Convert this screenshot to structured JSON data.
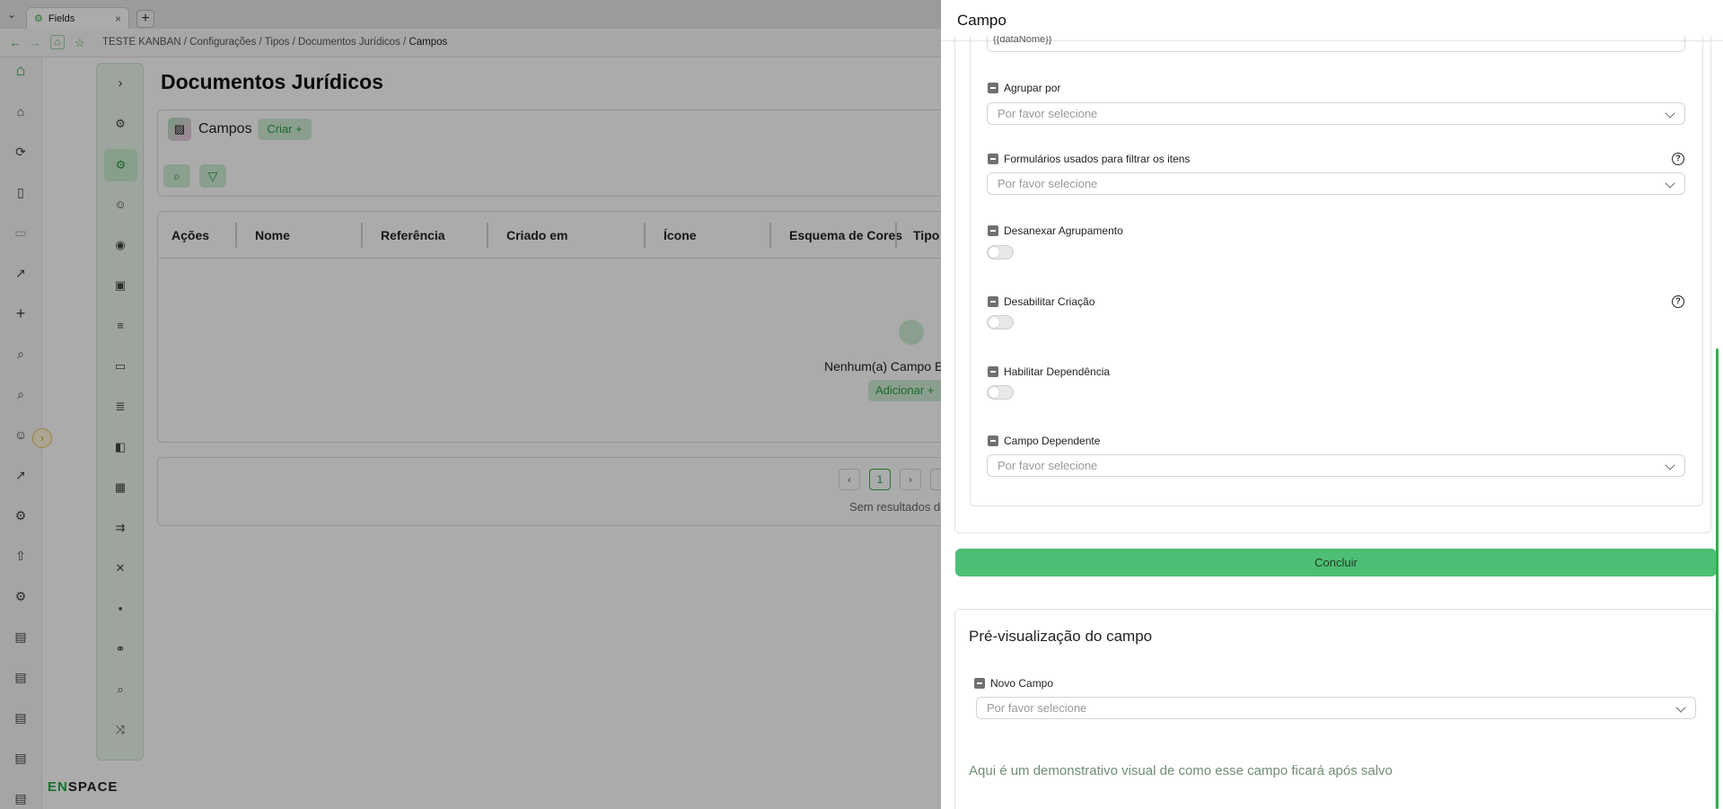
{
  "browser": {
    "tab_title": "Fields",
    "tab_close": "×",
    "new_tab": "+",
    "breadcrumbs": [
      "TESTE KANBAN",
      "Configurações",
      "Tipos",
      "Documentos Jurídicos",
      "Campos"
    ],
    "separator": "/"
  },
  "brand": {
    "logo_text_a": "EN",
    "logo_text_b": "SPACE"
  },
  "main": {
    "page_title": "Documentos Jurídicos",
    "section_title": "Campos",
    "criar_label": "Criar +",
    "table": {
      "headers": [
        "Ações",
        "Nome",
        "Referência",
        "Criado em",
        "Ícone",
        "Esquema de Cores",
        "Tipo"
      ]
    },
    "empty_text": "Nenhum(a) Campo Enc",
    "add_label": "Adicionar +",
    "pager": {
      "prev": "‹",
      "current": "1",
      "next": "›"
    },
    "no_results": "Sem resultados de"
  },
  "drawer": {
    "title": "Campo",
    "top_input_value": "{{dataNome}}",
    "fields": [
      {
        "label": "Agrupar por",
        "placeholder": "Por favor selecione"
      },
      {
        "label": "Formulários usados para filtrar os itens",
        "placeholder": "Por favor selecione",
        "help": "?"
      },
      {
        "label": "Desanexar Agrupamento"
      },
      {
        "label": "Desabilitar Criação",
        "help": "?"
      },
      {
        "label": "Habilitar Dependência"
      },
      {
        "label": "Campo Dependente",
        "placeholder": "Por favor selecione"
      }
    ],
    "toggles": [
      {
        "label": "Desanexar Agrupamento",
        "on": false
      },
      {
        "label": "Desabilitar Criação",
        "on": false
      },
      {
        "label": "Habilitar Dependência",
        "on": false
      }
    ],
    "concluir_label": "Concluir",
    "preview": {
      "title": "Pré-visualização do campo",
      "field_label": "Novo Campo",
      "field_placeholder": "Por favor selecione",
      "demo_text": "Aqui é um demonstrativo visual de como esse campo ficará após salvo"
    }
  },
  "colors": {
    "accent": "#4dbf74",
    "accent_light": "#cfeed6",
    "scrollbar": "#2fb14a"
  }
}
